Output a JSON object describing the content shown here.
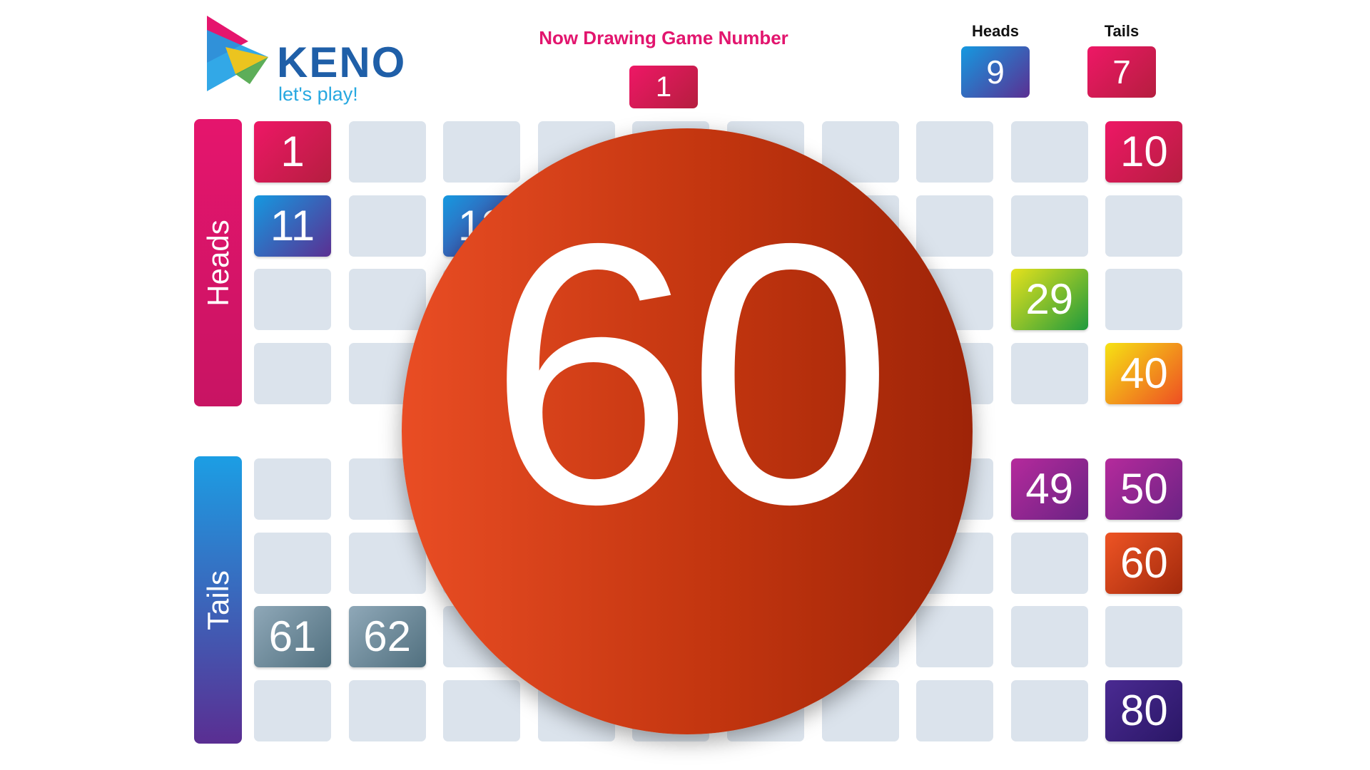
{
  "logo": {
    "word": "KENO",
    "tagline": "let's play!"
  },
  "drawing": {
    "label": "Now Drawing Game Number",
    "game_number": "1"
  },
  "counters": {
    "heads": {
      "label": "Heads",
      "value": "9"
    },
    "tails": {
      "label": "Tails",
      "value": "7"
    }
  },
  "side_labels": {
    "heads": "Heads",
    "tails": "Tails"
  },
  "current_ball": "60",
  "colors": {
    "empty_cell": "#dbe3ec",
    "ball": "#c2350f",
    "accent_pink": "#e2156e"
  },
  "drawn_numbers": [
    {
      "n": 1,
      "from": "#ee1766",
      "to": "#b51e3f"
    },
    {
      "n": 10,
      "from": "#ee1766",
      "to": "#b51e3f"
    },
    {
      "n": 11,
      "from": "#1599e0",
      "to": "#5b2f92"
    },
    {
      "n": 13,
      "from": "#1599e0",
      "to": "#5b2f92"
    },
    {
      "n": 29,
      "from": "#e6e21c",
      "to": "#1f9a3d"
    },
    {
      "n": 40,
      "from": "#f6e214",
      "to": "#ee4e23"
    },
    {
      "n": 49,
      "from": "#b52a9c",
      "to": "#6a2384"
    },
    {
      "n": 50,
      "from": "#b52a9c",
      "to": "#6a2384"
    },
    {
      "n": 60,
      "from": "#ee5424",
      "to": "#a2290c"
    },
    {
      "n": 61,
      "from": "#8fa8b8",
      "to": "#51707f"
    },
    {
      "n": 62,
      "from": "#8fa8b8",
      "to": "#51707f"
    },
    {
      "n": 80,
      "from": "#4a2a92",
      "to": "#2a1766"
    }
  ]
}
